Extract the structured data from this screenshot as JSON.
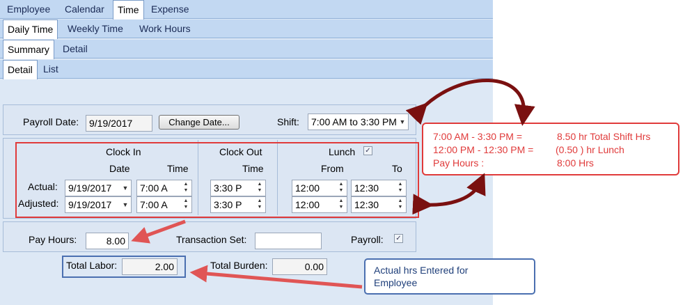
{
  "nav": {
    "main_tabs": [
      "Employee",
      "Calendar",
      "Time",
      "Expense"
    ],
    "time_tabs": [
      "Daily Time",
      "Weekly Time",
      "Work Hours"
    ],
    "view_tabs": [
      "Summary",
      "Detail"
    ],
    "sub_tabs": [
      "Detail",
      "List"
    ]
  },
  "header": {
    "payroll_date_label": "Payroll Date:",
    "payroll_date_value": "9/19/2017",
    "change_date_button": "Change Date...",
    "shift_label": "Shift:",
    "shift_value": "7:00 AM to 3:30 PM"
  },
  "clock": {
    "clock_in_title": "Clock In",
    "clock_out_title": "Clock Out",
    "lunch_title": "Lunch",
    "date_header": "Date",
    "time_header": "Time",
    "from_header": "From",
    "to_header": "To",
    "actual_label": "Actual:",
    "adjusted_label": "Adjusted:",
    "actual": {
      "in_date": "9/19/2017",
      "in_time": "7:00 A",
      "out_time": "3:30 P",
      "lunch_from": "12:00",
      "lunch_to": "12:30"
    },
    "adjusted": {
      "in_date": "9/19/2017",
      "in_time": "7:00 A",
      "out_time": "3:30 P",
      "lunch_from": "12:00",
      "lunch_to": "12:30"
    },
    "lunch_checked": true
  },
  "pay": {
    "pay_hours_label": "Pay Hours:",
    "pay_hours_value": "8.00",
    "transaction_set_label": "Transaction Set:",
    "transaction_set_value": "",
    "payroll_label": "Payroll:",
    "payroll_checked": true
  },
  "totals": {
    "total_labor_label": "Total Labor:",
    "total_labor_value": "2.00",
    "total_burden_label": "Total Burden:",
    "total_burden_value": "0.00"
  },
  "annotations": {
    "shift_note": {
      "line1_range": "7:00 AM - 3:30 PM =",
      "line1_value": "8.50 hr  Total Shift Hrs",
      "line2_range": "12:00 PM - 12:30 PM =",
      "line2_value": "(0.50 ) hr Lunch",
      "line3_range": "Pay Hours :",
      "line3_value": "8:00 Hrs"
    },
    "labor_note": "Actual hrs Entered for Employee"
  },
  "colors": {
    "annotation_red": "#e03a3a",
    "arrow_dark_red": "#7a1010",
    "callout_blue": "#4a6fb0"
  }
}
